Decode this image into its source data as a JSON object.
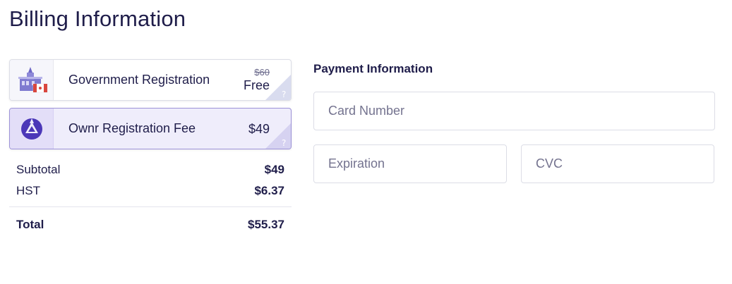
{
  "page": {
    "title": "Billing Information"
  },
  "items": [
    {
      "label": "Government Registration",
      "original_price": "$60",
      "price": "Free",
      "help": "?",
      "icon": "building-with-flag-icon"
    },
    {
      "label": "Ownr Registration Fee",
      "price": "$49",
      "help": "?",
      "icon": "ownr-logo-icon",
      "selected": true
    }
  ],
  "summary": {
    "subtotal_label": "Subtotal",
    "subtotal_value": "$49",
    "tax_label": "HST",
    "tax_value": "$6.37",
    "total_label": "Total",
    "total_value": "$55.37"
  },
  "payment": {
    "title": "Payment Information",
    "card_placeholder": "Card Number",
    "expiration_placeholder": "Expiration",
    "cvc_placeholder": "CVC"
  },
  "colors": {
    "text": "#1f1d4a",
    "accent": "#5a3fc8",
    "selected_bg": "#efedfb",
    "border": "#dcdde6"
  }
}
